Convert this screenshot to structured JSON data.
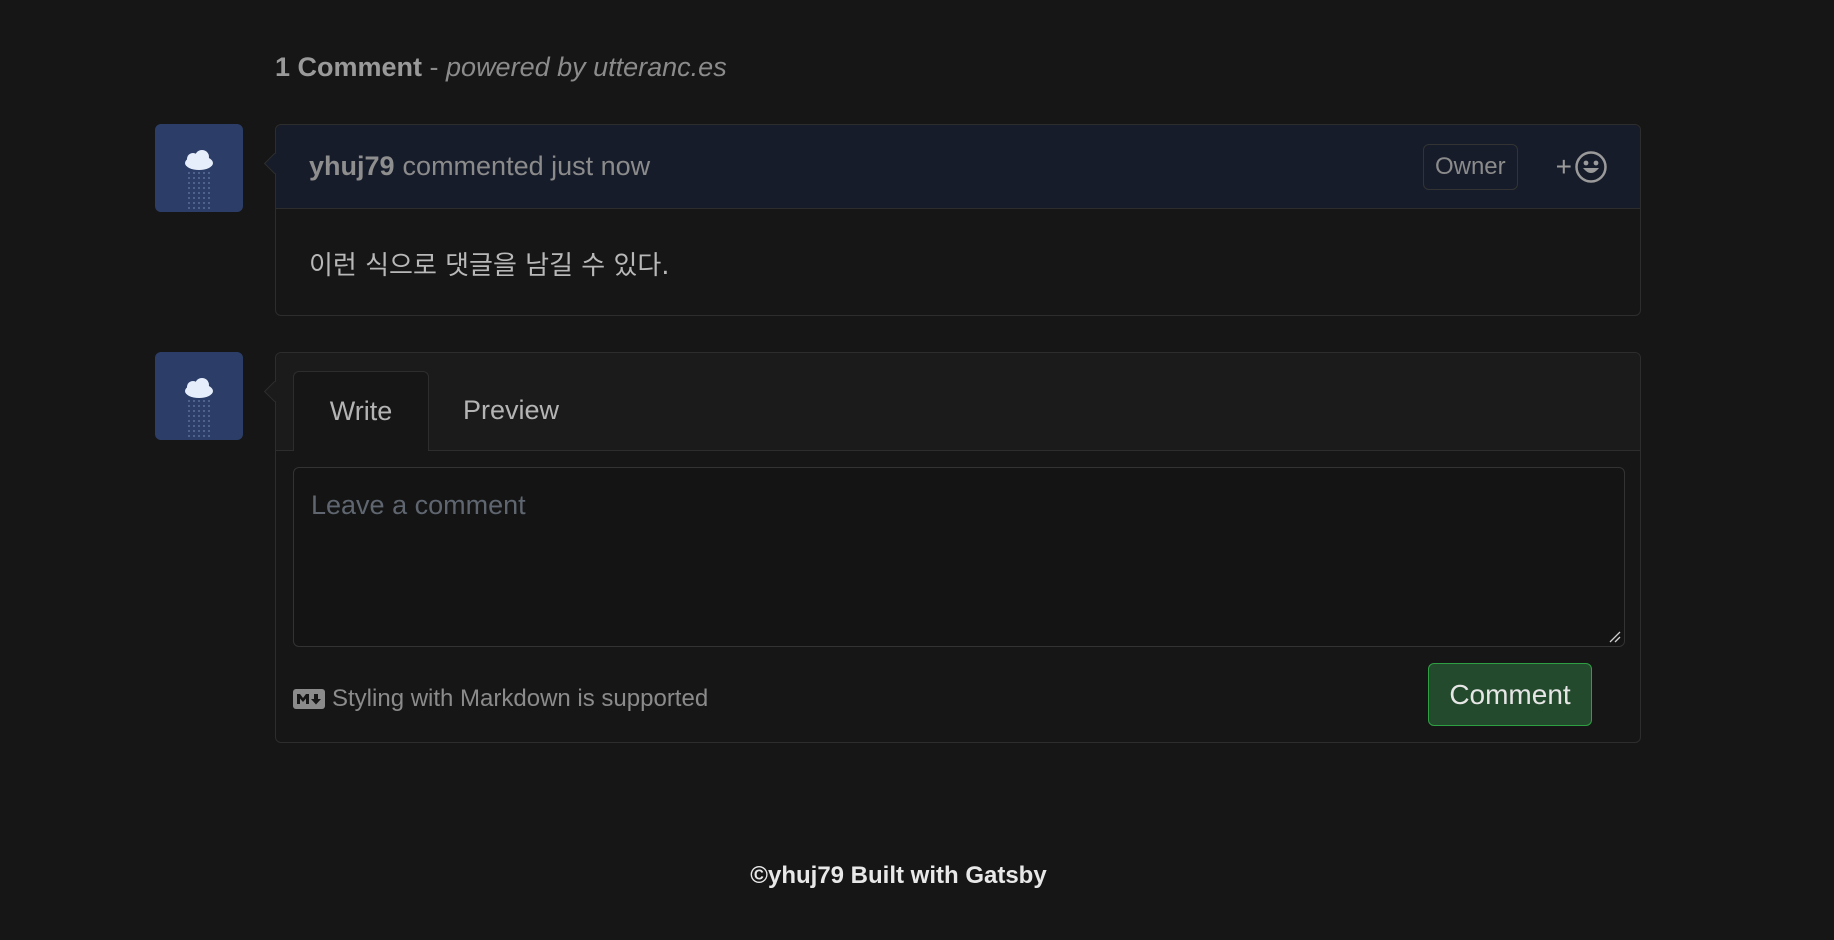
{
  "header": {
    "count_label": "1 Comment",
    "separator": " - ",
    "powered_by": "powered by utteranc.es"
  },
  "comment": {
    "author": "yhuj79",
    "meta": "commented just now",
    "badge": "Owner",
    "reaction_plus": "+",
    "body": "이런 식으로 댓글을 남길 수 있다."
  },
  "editor": {
    "tabs": [
      {
        "label": "Write",
        "active": true
      },
      {
        "label": "Preview",
        "active": false
      }
    ],
    "placeholder": "Leave a comment",
    "markdown_note": "Styling with Markdown is supported",
    "submit_label": "Comment"
  },
  "footer": {
    "text": "©yhuj79 Built with Gatsby"
  },
  "icons": {
    "avatar": "cloud-rain-icon",
    "reaction": "smiley-icon",
    "markdown": "markdown-icon",
    "resize": "resize-handle-icon"
  },
  "colors": {
    "background": "#161616",
    "comment_header": "#161c2a",
    "avatar_bg": "#2c3e67",
    "submit_bg": "#234a2c",
    "submit_border": "#2ea043"
  }
}
